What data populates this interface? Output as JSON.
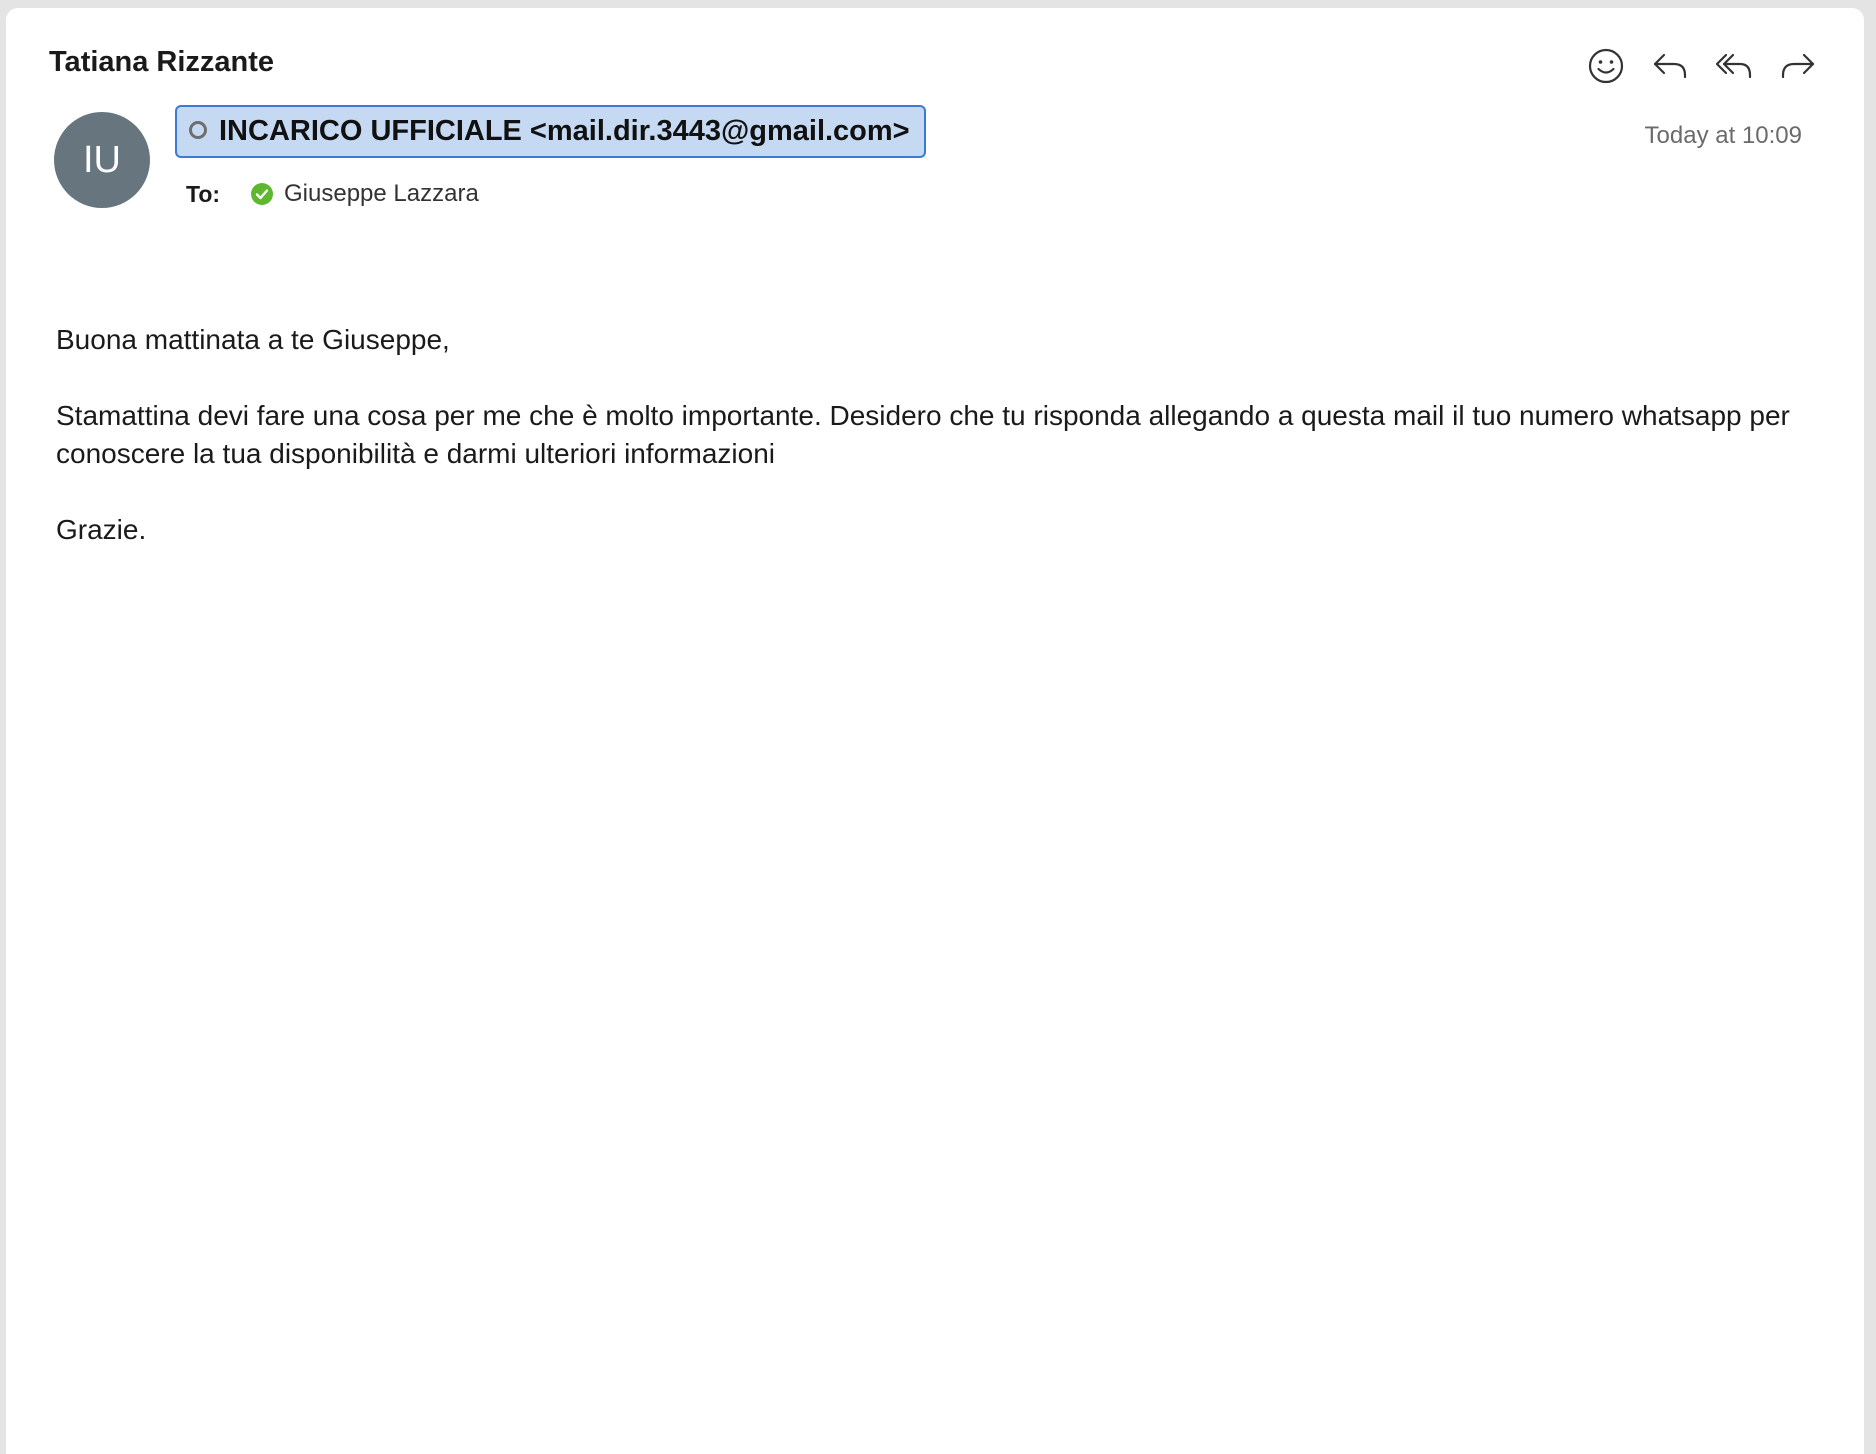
{
  "message": {
    "subject": "Tatiana Rizzante",
    "avatar_initials": "IU",
    "sender": "INCARICO UFFICIALE <mail.dir.3443@gmail.com>",
    "date": "Today at 10:09",
    "to_label": "To:",
    "recipient": "Giuseppe Lazzara",
    "body": {
      "greeting": "Buona mattinata a te Giuseppe,",
      "paragraph": "Stamattina devi fare una cosa per me che è molto importante. Desidero che tu risponda allegando a questa mail il tuo numero whatsapp per conoscere la tua disponibilità e darmi ulteriori informazioni",
      "closing": "Grazie."
    }
  },
  "toolbar": {
    "icons": [
      "smiley-icon",
      "reply-icon",
      "reply-all-icon",
      "forward-icon"
    ]
  },
  "colors": {
    "avatar_bg": "#67767e",
    "chip_bg": "#c5d9f3",
    "chip_border": "#3d7ad8",
    "verified_green": "#5eb82f"
  }
}
